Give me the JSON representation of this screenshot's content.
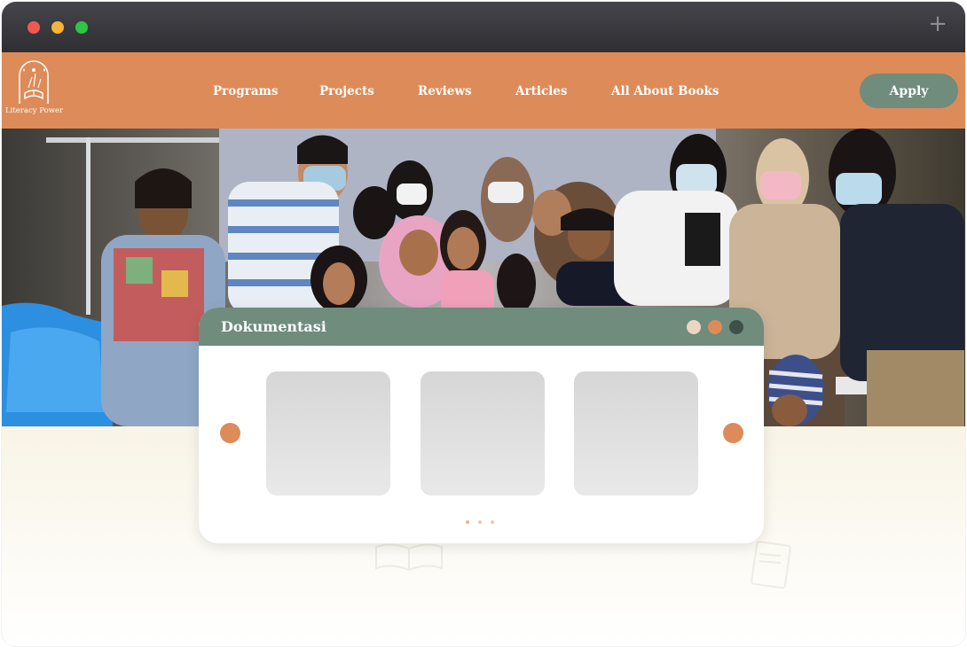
{
  "window": {
    "controls": [
      "close",
      "minimize",
      "maximize"
    ],
    "new_tab_icon": "plus-icon"
  },
  "navbar": {
    "logo_text": "Literacy Power",
    "links": [
      "Programs",
      "Projects",
      "Reviews",
      "Articles",
      "All About Books"
    ],
    "apply_label": "Apply",
    "colors": {
      "bar": "#dd8b59",
      "apply": "#6f8c7d"
    }
  },
  "hero": {
    "image": "group-photo-of-volunteers-and-children"
  },
  "gallery": {
    "title": "Dokumentasi",
    "header_dots": [
      "#ecd6c1",
      "#dd8b59",
      "#3d5147"
    ],
    "prev_icon": "circle-arrow-left",
    "next_icon": "circle-arrow-right",
    "slides": 3,
    "page_dots": 3,
    "active_page": 1
  }
}
